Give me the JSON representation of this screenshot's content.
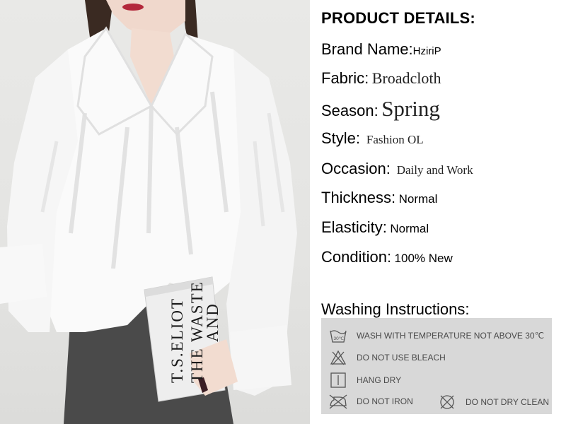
{
  "photo": {
    "book_author": "T.S.ELIOT",
    "book_title_line1": "THE WASTE",
    "book_title_line2": "AND"
  },
  "details": {
    "heading": "PRODUCT DETAILS:",
    "rows": [
      {
        "label": "Brand Name:",
        "value": "HziriP"
      },
      {
        "label": "Fabric:",
        "value": "Broadcloth"
      },
      {
        "label": "Season:",
        "value": "Spring"
      },
      {
        "label": "Style:",
        "value": "Fashion OL"
      },
      {
        "label": "Occasion:",
        "value": "Daily and Work"
      },
      {
        "label": "Thickness:",
        "value": "Normal"
      },
      {
        "label": "Elasticity:",
        "value": "Normal"
      },
      {
        "label": "Condition:",
        "value": "100% New"
      }
    ]
  },
  "washing": {
    "title": "Washing Instructions:",
    "items": [
      {
        "icon": "wash-30-icon",
        "label": "WASH WITH TEMPERATURE NOT ABOVE 30℃",
        "icon_text": "30℃"
      },
      {
        "icon": "no-bleach-icon",
        "label": "DO NOT USE BLEACH"
      },
      {
        "icon": "hang-dry-icon",
        "label": "HANG DRY"
      },
      {
        "icon": "no-iron-icon",
        "label": "DO NOT IRON"
      },
      {
        "icon": "no-dry-clean-icon",
        "label": "DO NOT DRY CLEAN"
      }
    ]
  },
  "colors": {
    "panel_background": "#d8d8d8",
    "panel_text": "#4a4a4a",
    "blouse": "#fafafa",
    "skirt": "#4a4a4a"
  }
}
